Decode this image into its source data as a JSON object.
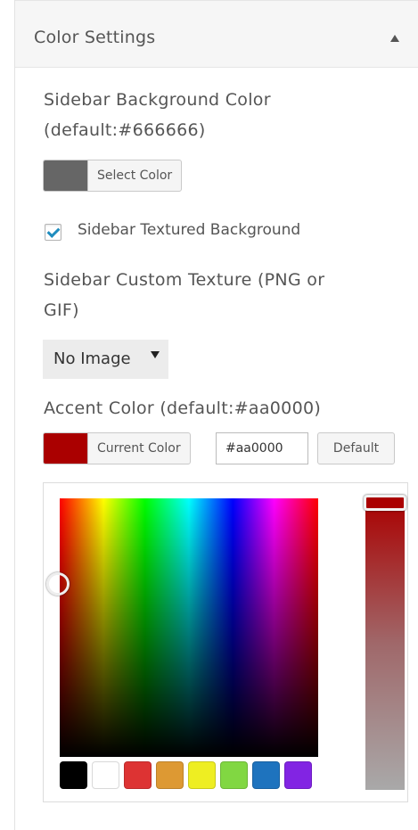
{
  "panel": {
    "title": "Color Settings"
  },
  "sidebar_bg": {
    "label_line1": "Sidebar Background Color",
    "label_line2": "(default:#666666)",
    "button_label": "Select Color",
    "swatch_color": "#666666"
  },
  "textured": {
    "checked": true,
    "label": "Sidebar Textured Background"
  },
  "custom_texture": {
    "label_line1": "Sidebar Custom Texture (PNG or",
    "label_line2": "GIF)",
    "selected": "No Image"
  },
  "accent": {
    "label": "Accent Color (default:#aa0000)",
    "button_label": "Current Color",
    "swatch_color": "#aa0000",
    "hex_value": "#aa0000",
    "default_label": "Default"
  },
  "palette": [
    "#000000",
    "#ffffff",
    "#dd3333",
    "#dd9933",
    "#eeee22",
    "#81d742",
    "#1e73be",
    "#8224e3"
  ]
}
